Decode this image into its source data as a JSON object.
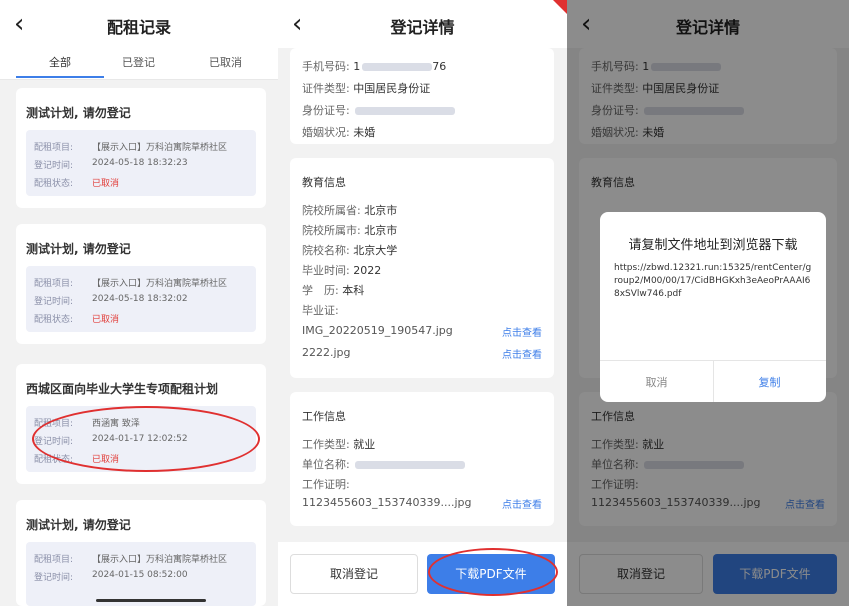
{
  "panel1": {
    "title": "配租记录",
    "tabs": [
      "全部",
      "已登记",
      "已取消"
    ],
    "records": [
      {
        "title": "测试计划, 请勿登记",
        "lines": [
          [
            "配租项目:",
            "【展示入口】万科泊寓院草桥社区"
          ],
          [
            "登记时间:",
            "2024-05-18 18:32:23"
          ],
          [
            "配租状态:",
            "已取消"
          ]
        ]
      },
      {
        "title": "测试计划, 请勿登记",
        "lines": [
          [
            "配租项目:",
            "【展示入口】万科泊寓院草桥社区"
          ],
          [
            "登记时间:",
            "2024-05-18 18:32:02"
          ],
          [
            "配租状态:",
            "已取消"
          ]
        ]
      },
      {
        "title": "西城区面向毕业大学生专项配租计划",
        "lines": [
          [
            "配租项目:",
            "西涵寓 致泽"
          ],
          [
            "登记时间:",
            "2024-01-17 12:02:52"
          ],
          [
            "配租状态:",
            "已取消"
          ]
        ]
      },
      {
        "title": "测试计划, 请勿登记",
        "lines": [
          [
            "配租项目:",
            "【展示入口】万科泊寓院草桥社区"
          ],
          [
            "登记时间:",
            "2024-01-15 08:52:00"
          ]
        ]
      }
    ]
  },
  "panel2": {
    "title": "登记详情",
    "personal": {
      "phone_label": "手机号码:",
      "phone_value": "1",
      "phone_tail": "76",
      "id_type_label": "证件类型:",
      "id_type_value": "中国居民身份证",
      "id_no_label": "身份证号:",
      "id_no_value": "",
      "marital_label": "婚姻状况:",
      "marital_value": "未婚"
    },
    "education": {
      "title": "教育信息",
      "province_label": "院校所属省:",
      "province_value": "北京市",
      "city_label": "院校所属市:",
      "city_value": "北京市",
      "school_label": "院校名称:",
      "school_value": "北京大学",
      "grad_label": "毕业时间:",
      "grad_value": "2022",
      "degree_label": "学　历:",
      "degree_value": "本科",
      "cert_label": "毕业证:",
      "file1": "IMG_20220519_190547.jpg",
      "file2": "2222.jpg",
      "view": "点击查看"
    },
    "work": {
      "title": "工作信息",
      "type_label": "工作类型:",
      "type_value": "就业",
      "unit_label": "单位名称:",
      "proof_label": "工作证明:",
      "file": "1123455603_153740339....jpg",
      "view": "点击查看"
    },
    "buttons": {
      "cancel": "取消登记",
      "download": "下载PDF文件"
    }
  },
  "panel3": {
    "title": "登记详情",
    "personal": {
      "phone_label": "手机号码:",
      "phone_value": "1",
      "id_type_label": "证件类型:",
      "id_type_value": "中国居民身份证",
      "id_no_label": "身份证号:",
      "id_no_value": "",
      "marital_label": "婚姻状况:",
      "marital_value": "未婚"
    },
    "education_title": "教育信息",
    "work": {
      "title": "工作信息",
      "type_label": "工作类型:",
      "type_value": "就业",
      "unit_label": "单位名称:",
      "proof_label": "工作证明:",
      "file": "1123455603_153740339....jpg",
      "view": "点击查看"
    },
    "dialog": {
      "title": "请复制文件地址到浏览器下载",
      "url": "https://zbwd.12321.run:15325/rentCenter/group2/M00/00/17/CidBHGKxh3eAeoPrAAAI68xSVlw746.pdf",
      "cancel": "取消",
      "copy": "复制"
    },
    "buttons": {
      "cancel": "取消登记",
      "download": "下载PDF文件"
    }
  },
  "colors": {
    "accent": "#3d7ee8",
    "danger": "#e2403c",
    "annotation": "#e03030"
  }
}
